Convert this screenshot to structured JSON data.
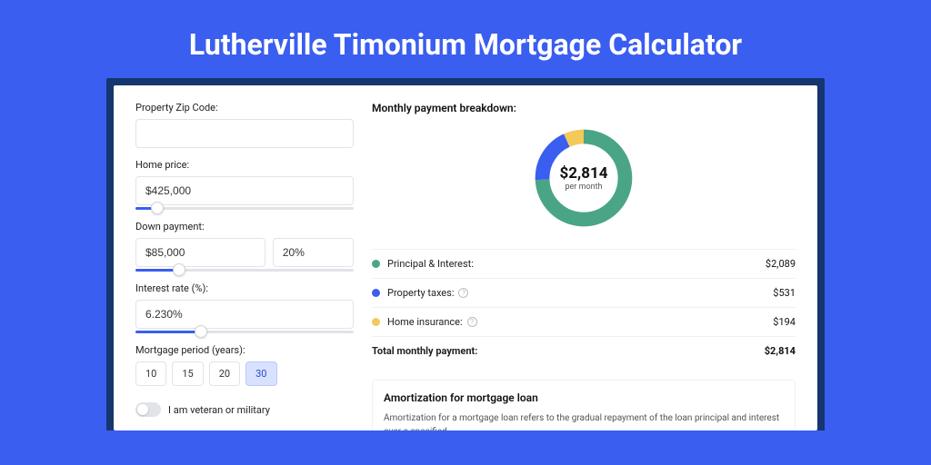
{
  "page_title": "Lutherville Timonium Mortgage Calculator",
  "colors": {
    "principal": "#4aa586",
    "taxes": "#3a5ef0",
    "insurance": "#f3c95a"
  },
  "form": {
    "zip": {
      "label": "Property Zip Code:",
      "value": ""
    },
    "home_price": {
      "label": "Home price:",
      "value": "$425,000",
      "slider_pct": 10
    },
    "down_payment": {
      "label": "Down payment:",
      "value": "$85,000",
      "percent": "20%",
      "slider_pct": 20
    },
    "interest_rate": {
      "label": "Interest rate (%):",
      "value": "6.230%",
      "slider_pct": 30
    },
    "period": {
      "label": "Mortgage period (years):",
      "options": [
        "10",
        "15",
        "20",
        "30"
      ],
      "selected": "30"
    },
    "veteran": {
      "label": "I am veteran or military",
      "on": false
    }
  },
  "breakdown": {
    "title": "Monthly payment breakdown:",
    "total_amount": "$2,814",
    "total_sub": "per month",
    "items": [
      {
        "label": "Principal & Interest:",
        "value": "$2,089",
        "colorKey": "principal",
        "help": false
      },
      {
        "label": "Property taxes:",
        "value": "$531",
        "colorKey": "taxes",
        "help": true
      },
      {
        "label": "Home insurance:",
        "value": "$194",
        "colorKey": "insurance",
        "help": true
      }
    ],
    "total_label": "Total monthly payment:",
    "total_value": "$2,814"
  },
  "amortization": {
    "title": "Amortization for mortgage loan",
    "text": "Amortization for a mortgage loan refers to the gradual repayment of the loan principal and interest over a specified"
  },
  "chart_data": {
    "type": "pie",
    "title": "Monthly payment breakdown",
    "series": [
      {
        "name": "Principal & Interest",
        "value": 2089
      },
      {
        "name": "Property taxes",
        "value": 531
      },
      {
        "name": "Home insurance",
        "value": 194
      }
    ],
    "total": 2814,
    "unit": "USD per month"
  }
}
